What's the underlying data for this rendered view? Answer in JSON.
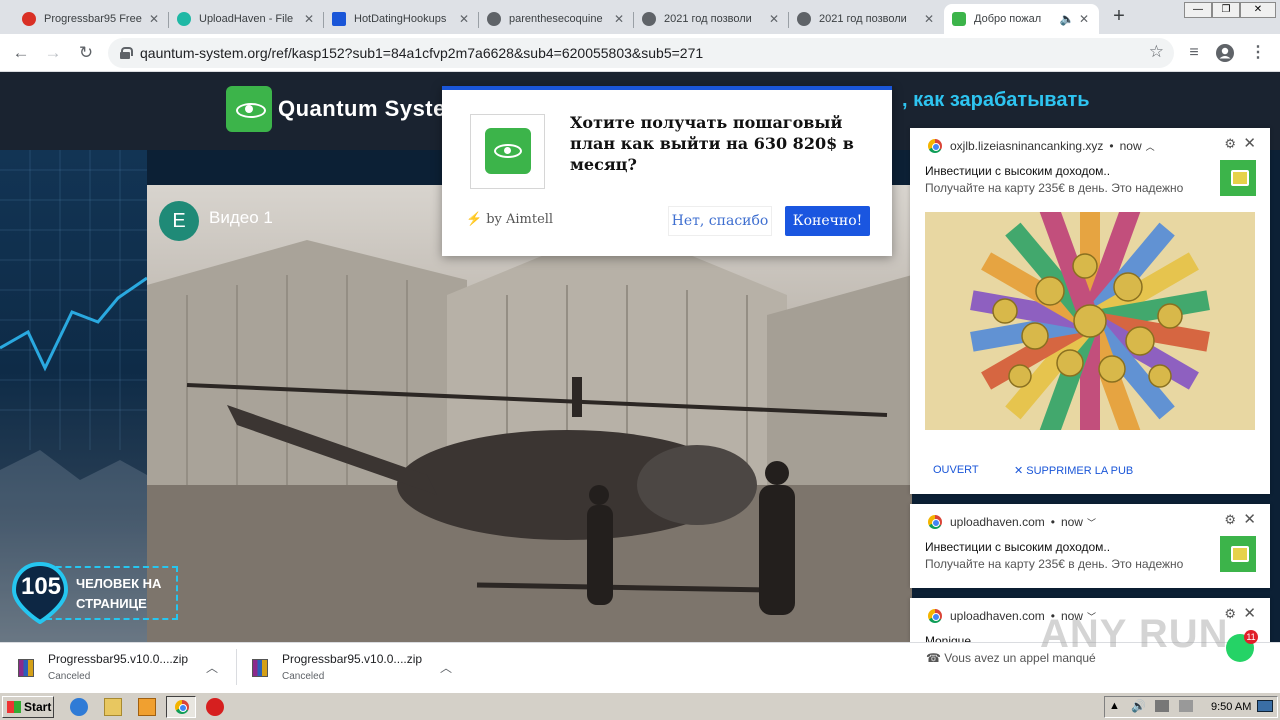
{
  "browser": {
    "tabs": [
      {
        "title": "Progressbar95 Free",
        "favicon": "progressbar-icon",
        "color": "#d93025",
        "active": false
      },
      {
        "title": "UploadHaven - File",
        "favicon": "uploadhaven-icon",
        "color": "#1fb8a5",
        "active": false
      },
      {
        "title": "HotDatingHookups",
        "favicon": "hotdating-icon",
        "color": "#1a56d8",
        "active": false
      },
      {
        "title": "parenthesecoquine",
        "favicon": "globe-icon",
        "color": "#5f6368",
        "active": false
      },
      {
        "title": "2021 год позволи",
        "favicon": "globe-icon",
        "color": "#5f6368",
        "active": false
      },
      {
        "title": "2021 год позволи",
        "favicon": "globe-icon",
        "color": "#5f6368",
        "active": false
      },
      {
        "title": "Добро пожал",
        "favicon": "quantum-icon",
        "color": "#3cb44a",
        "active": true
      }
    ],
    "url": "qauntum-system.org/ref/kasp152?sub1=84a1cfvp2m7a6628&sub4=620055803&sub5=271"
  },
  "site": {
    "name": "Quantum System",
    "headline": ", как зарабатывать",
    "video": {
      "avatar_letter": "E",
      "title": "Видео 1"
    },
    "viewers": {
      "count": "105",
      "label": "ЧЕЛОВЕК НА СТРАНИЦЕ"
    }
  },
  "push_prompt": {
    "text": "Хотите получать пошаговый план как выйти на 630 820$ в месяц?",
    "credit": "by Aimtell",
    "no_label": "Нет, спасибо",
    "yes_label": "Конечно!"
  },
  "notifications": [
    {
      "source": "oxjlb.lizeiasninancanking.xyz",
      "time": "now",
      "title": "Инвестиции с высоким доходом..",
      "body": "Получайте на карту 235€ в день. Это надежно",
      "open_label": "OUVERT",
      "remove_label": "SUPPRIMER LA PUB"
    },
    {
      "source": "uploadhaven.com",
      "time": "now",
      "title": "Инвестиции с высоким доходом..",
      "body": "Получайте на карту 235€ в день. Это надежно"
    },
    {
      "source": "uploadhaven.com",
      "time": "now",
      "title": "Monique",
      "body": "Vous avez un appel manqué"
    }
  ],
  "downloads": [
    {
      "name": "Progressbar95.v10.0....zip",
      "status": "Canceled"
    },
    {
      "name": "Progressbar95.v10.0....zip",
      "status": "Canceled"
    }
  ],
  "taskbar": {
    "start_label": "Start",
    "time": "9:50 AM",
    "chat_badge": "11"
  },
  "watermark": "ANY RUN"
}
